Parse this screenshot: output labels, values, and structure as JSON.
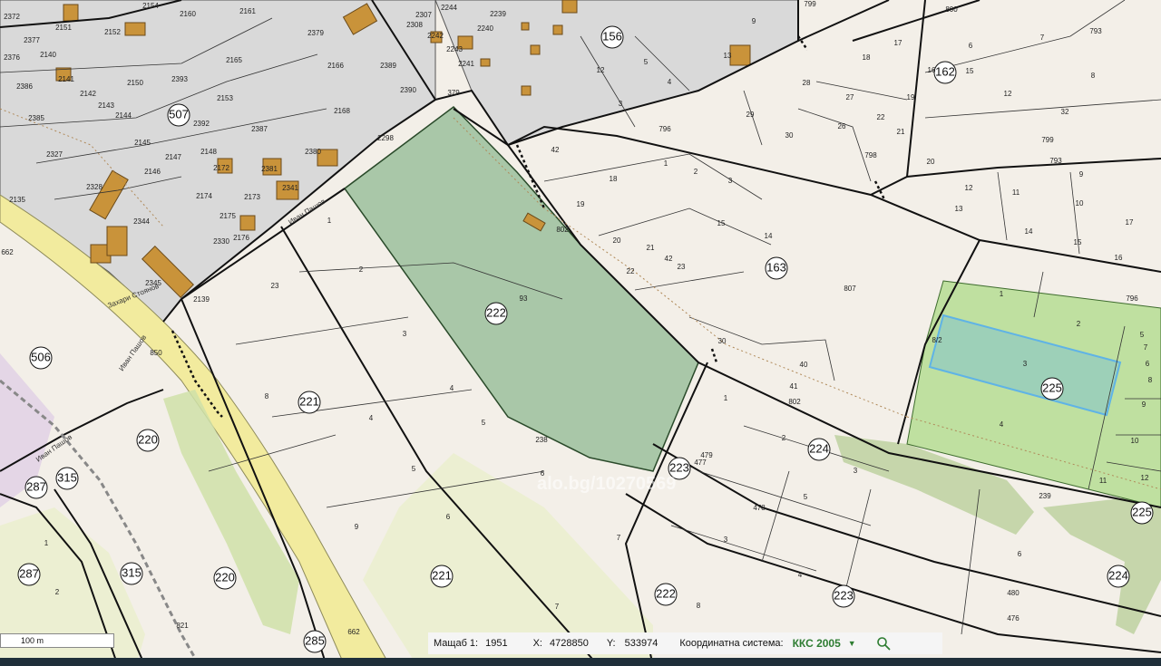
{
  "map": {
    "highlight_color": "#5fb3e6",
    "forest_color": "#a9c7a8",
    "green_plot_color": "#bfe0a0",
    "block_numbers": [
      "507",
      "156",
      "162",
      "163",
      "222",
      "506",
      "221",
      "220",
      "315",
      "287",
      "315",
      "287",
      "221",
      "222",
      "223",
      "223",
      "224",
      "225",
      "224",
      "225",
      "223",
      "220",
      "285"
    ],
    "plot_numbers": [
      "2372",
      "2151",
      "2154",
      "2160",
      "2161",
      "2377",
      "2376",
      "2140",
      "2152",
      "2165",
      "2379",
      "2166",
      "2389",
      "2390",
      "2386",
      "2141",
      "2142",
      "2150",
      "2393",
      "2153",
      "2385",
      "2143",
      "2144",
      "2392",
      "2168",
      "2387",
      "2327",
      "2145",
      "2147",
      "2148",
      "2172",
      "2381",
      "2380",
      "2135",
      "2146",
      "2328",
      "2174",
      "2173",
      "2341",
      "2344",
      "2175",
      "2176",
      "2330",
      "2345",
      "2139",
      "2307",
      "2244",
      "2239",
      "2308",
      "2242",
      "2240",
      "2243",
      "2241",
      "2298",
      "799",
      "800",
      "793",
      "9",
      "13",
      "12",
      "5",
      "4",
      "3",
      "18",
      "17",
      "16",
      "15",
      "6",
      "7",
      "8",
      "12",
      "19",
      "27",
      "28",
      "29",
      "22",
      "21",
      "26",
      "30",
      "32",
      "799",
      "20",
      "798",
      "796",
      "793",
      "42",
      "1",
      "2",
      "3",
      "18",
      "19",
      "15",
      "14",
      "20",
      "21",
      "22",
      "23",
      "42",
      "802",
      "12",
      "11",
      "13",
      "9",
      "10",
      "14",
      "15",
      "16",
      "17",
      "796",
      "807",
      "1",
      "2",
      "3",
      "4",
      "5",
      "6",
      "7",
      "8",
      "9",
      "10",
      "11",
      "12",
      "8/2",
      "23",
      "2",
      "1",
      "3",
      "8",
      "4",
      "5",
      "6",
      "9",
      "7",
      "93",
      "4",
      "5",
      "238",
      "6",
      "30",
      "40",
      "41",
      "802",
      "1",
      "2",
      "3",
      "4",
      "5",
      "6",
      "7",
      "8",
      "477",
      "478",
      "479",
      "480",
      "476",
      "239",
      "821",
      "662",
      "662",
      "379",
      "850",
      "1",
      "2",
      "3"
    ],
    "street_labels": [
      "Иван Пашов",
      "Захари Стоянов",
      "Иван Пашов",
      "Иван Пашов"
    ],
    "watermark": "alo.bg/10270569"
  },
  "scale_bar": {
    "label": "100 m"
  },
  "status": {
    "scale_label": "Мащаб 1:",
    "scale_value": "1951",
    "x_label": "X:",
    "x_value": "4728850",
    "y_label": "Y:",
    "y_value": "533974",
    "cs_label": "Координатна система:",
    "cs_value": "ККС 2005",
    "dropdown_icon": "▼",
    "search_icon": "search-icon"
  }
}
